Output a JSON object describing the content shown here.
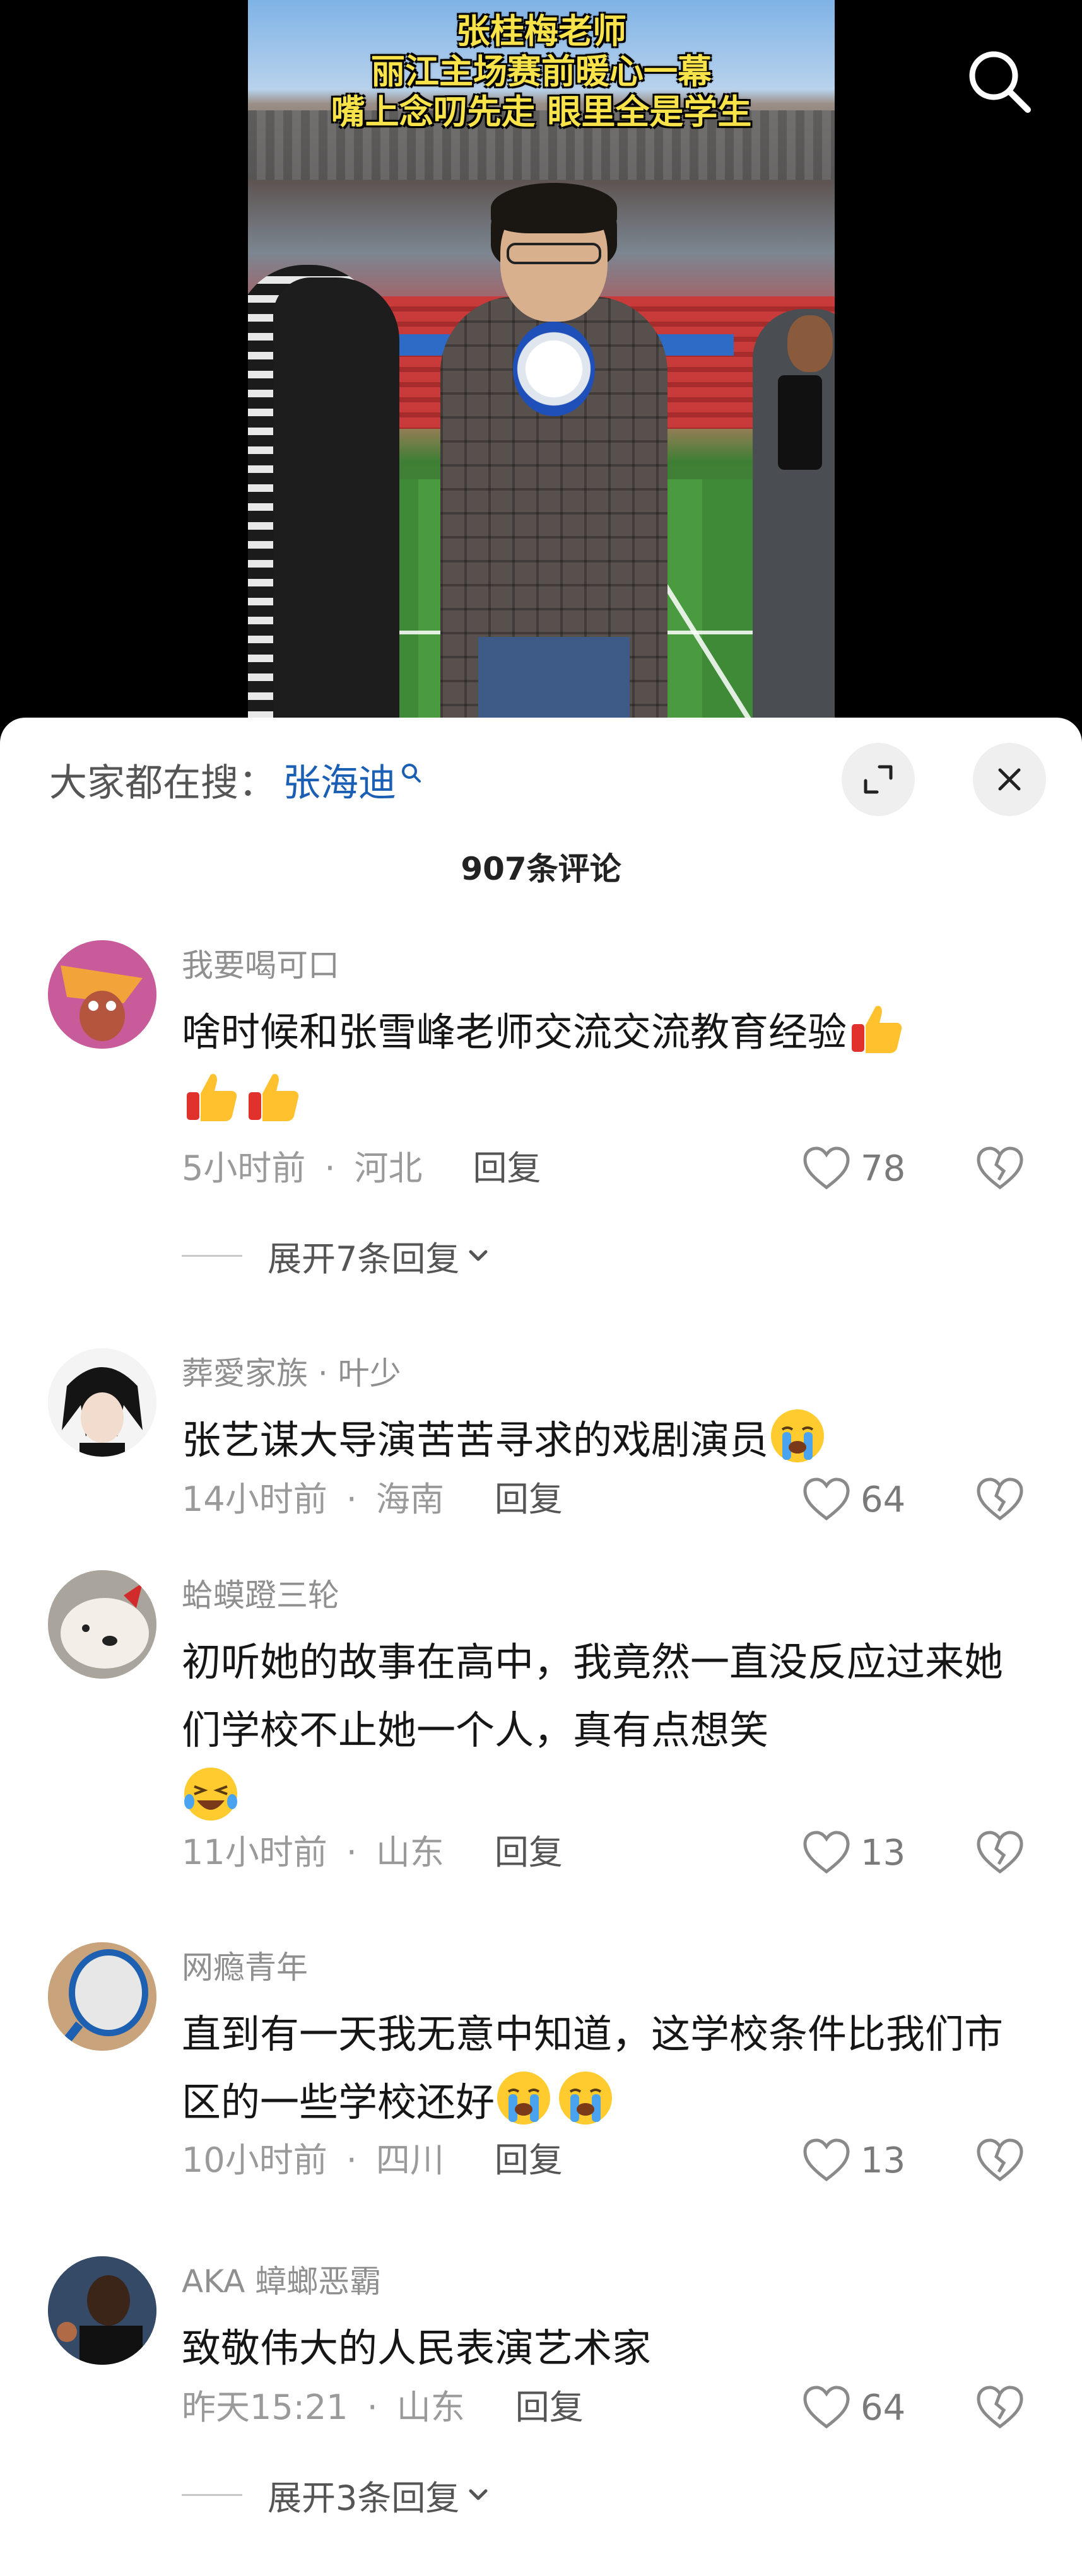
{
  "video": {
    "caption_lines": [
      "张桂梅老师",
      "丽江主场赛前暖心一幕",
      "嘴上念叨先走 眼里全是学生"
    ]
  },
  "trending": {
    "prefix": "大家都在搜：",
    "term": "张海迪"
  },
  "comments_header": {
    "count_label": "907条评论"
  },
  "comments": [
    {
      "username": "我要喝可口",
      "text": "啥时候和张雪峰老师交流交流教育经验",
      "emoji": [
        "thumbs-up",
        "thumbs-up",
        "thumbs-up"
      ],
      "time": "5小时前",
      "location": "河北",
      "reply_label": "回复",
      "likes": "78",
      "expand_label": "展开7条回复"
    },
    {
      "username": "葬愛家族 · 叶少",
      "text": "张艺谋大导演苦苦寻求的戏剧演员",
      "emoji": [
        "loudly-crying"
      ],
      "time": "14小时前",
      "location": "海南",
      "reply_label": "回复",
      "likes": "64"
    },
    {
      "username": "蛤蟆蹬三轮",
      "text": "初听她的故事在高中，我竟然一直没反应过来她们学校不止她一个人，真有点想笑",
      "emoji": [
        "rolling-laughing"
      ],
      "time": "11小时前",
      "location": "山东",
      "reply_label": "回复",
      "likes": "13"
    },
    {
      "username": "网瘾青年",
      "text": "直到有一天我无意中知道，这学校条件比我们市区的一些学校还好",
      "emoji": [
        "loudly-crying",
        "loudly-crying"
      ],
      "time": "10小时前",
      "location": "四川",
      "reply_label": "回复",
      "likes": "13"
    },
    {
      "username": "AKA 蟑螂恶霸",
      "text": "致敬伟大的人民表演艺术家",
      "emoji": [],
      "time": "昨天15:21",
      "location": "山东",
      "reply_label": "回复",
      "likes": "64",
      "expand_label": "展开3条回复"
    }
  ],
  "colors": {
    "trend_term": "#1b5fb5",
    "caption": "#f8e44a",
    "meta": "#9a9a9a"
  },
  "icons": {
    "search": "search-icon",
    "expand": "expand-icon",
    "close": "close-icon",
    "like": "heart-icon",
    "dislike": "broken-heart-icon",
    "chevron": "chevron-down-icon"
  }
}
